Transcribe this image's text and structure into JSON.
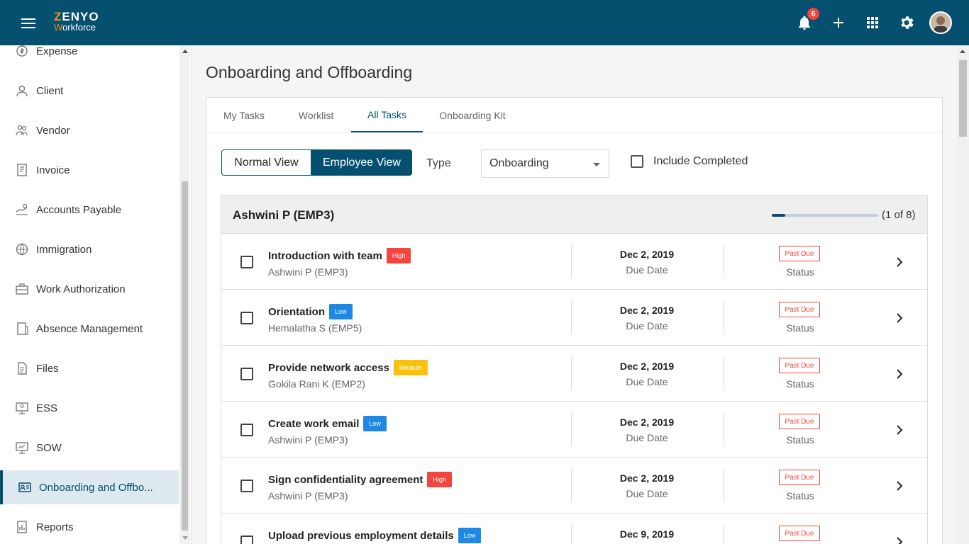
{
  "app": {
    "brand_top": "ZENYO",
    "brand_sub": "Workforce",
    "notification_count": "6"
  },
  "sidebar": {
    "items": [
      {
        "label": "Expense",
        "icon": "expense-icon"
      },
      {
        "label": "Client",
        "icon": "client-icon"
      },
      {
        "label": "Vendor",
        "icon": "vendor-icon"
      },
      {
        "label": "Invoice",
        "icon": "invoice-icon"
      },
      {
        "label": "Accounts Payable",
        "icon": "accounts-payable-icon"
      },
      {
        "label": "Immigration",
        "icon": "immigration-icon"
      },
      {
        "label": "Work Authorization",
        "icon": "briefcase-icon"
      },
      {
        "label": "Absence Management",
        "icon": "absence-icon"
      },
      {
        "label": "Files",
        "icon": "files-icon"
      },
      {
        "label": "ESS",
        "icon": "ess-icon"
      },
      {
        "label": "SOW",
        "icon": "sow-icon"
      },
      {
        "label": "Onboarding and Offbo...",
        "icon": "id-card-icon",
        "active": true
      },
      {
        "label": "Reports",
        "icon": "reports-icon"
      }
    ]
  },
  "main": {
    "title": "Onboarding and Offboarding",
    "tabs": [
      {
        "label": "My Tasks"
      },
      {
        "label": "Worklist"
      },
      {
        "label": "All Tasks",
        "active": true
      },
      {
        "label": "Onboarding Kit"
      }
    ],
    "filters": {
      "normal_view": "Normal View",
      "employee_view": "Employee View",
      "type_label": "Type",
      "type_value": "Onboarding",
      "include_completed": "Include Completed"
    },
    "employee": {
      "name": "Ashwini P (EMP3)",
      "progress_text": "(1 of 8)",
      "progress_fraction": 0.125
    },
    "tasks": [
      {
        "title": "Introduction with team",
        "priority": "High",
        "assignee": "Ashwini P (EMP3)",
        "due_date": "Dec 2, 2019",
        "due_label": "Due Date",
        "status": "Past Due",
        "status_label": "Status"
      },
      {
        "title": "Orientation",
        "priority": "Low",
        "assignee": "Hemalatha S (EMP5)",
        "due_date": "Dec 2, 2019",
        "due_label": "Due Date",
        "status": "Past Due",
        "status_label": "Status"
      },
      {
        "title": "Provide network access",
        "priority": "Medium",
        "assignee": "Gokila Rani K (EMP2)",
        "due_date": "Dec 2, 2019",
        "due_label": "Due Date",
        "status": "Past Due",
        "status_label": "Status"
      },
      {
        "title": "Create work email",
        "priority": "Low",
        "assignee": "Ashwini P (EMP3)",
        "due_date": "Dec 2, 2019",
        "due_label": "Due Date",
        "status": "Past Due",
        "status_label": "Status"
      },
      {
        "title": "Sign confidentiality agreement",
        "priority": "High",
        "assignee": "Ashwini P (EMP3)",
        "due_date": "Dec 2, 2019",
        "due_label": "Due Date",
        "status": "Past Due",
        "status_label": "Status"
      },
      {
        "title": "Upload previous employment details",
        "priority": "Low",
        "assignee": "",
        "due_date": "Dec 9, 2019",
        "due_label": "",
        "status": "Past Due",
        "status_label": ""
      }
    ]
  },
  "colors": {
    "primary": "#05506f",
    "accent": "#f28c28",
    "high": "#f2453d",
    "low": "#1e88e5",
    "medium": "#f9c10c"
  }
}
